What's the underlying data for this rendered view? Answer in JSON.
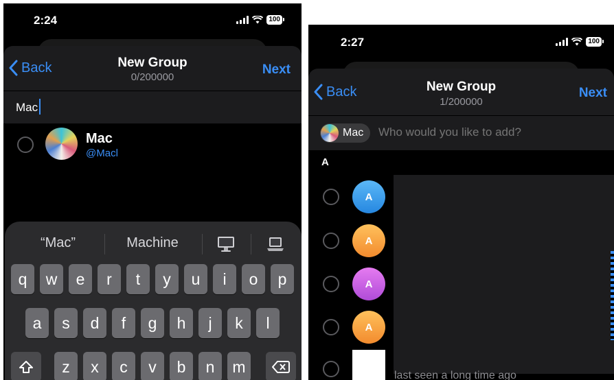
{
  "left": {
    "status": {
      "time": "2:24",
      "battery": "100"
    },
    "nav": {
      "back": "Back",
      "title": "New Group",
      "subtitle": "0/200000",
      "next": "Next"
    },
    "search": {
      "value": "Mac"
    },
    "result": {
      "name": "Mac",
      "username": "@Macl"
    },
    "keyboard": {
      "suggestions": [
        "“Mac”",
        "Machine"
      ],
      "row1": [
        "q",
        "w",
        "e",
        "r",
        "t",
        "y",
        "u",
        "i",
        "o",
        "p"
      ],
      "row2": [
        "a",
        "s",
        "d",
        "f",
        "g",
        "h",
        "j",
        "k",
        "l"
      ],
      "row3": [
        "z",
        "x",
        "c",
        "v",
        "b",
        "n",
        "m"
      ]
    }
  },
  "right": {
    "status": {
      "time": "2:27",
      "battery": "100"
    },
    "nav": {
      "back": "Back",
      "title": "New Group",
      "subtitle": "1/200000",
      "next": "Next"
    },
    "chip": {
      "label": "Mac"
    },
    "search": {
      "placeholder": "Who would you like to add?"
    },
    "section": {
      "header": "A"
    },
    "contacts": [
      {
        "initial": "A",
        "color": "#2f9be8"
      },
      {
        "initial": "A",
        "color": "#f5a13b"
      },
      {
        "initial": "A",
        "color": "#c15ee0"
      },
      {
        "initial": "A",
        "color": "#f5a13b"
      }
    ],
    "last_seen": "last seen a long time ago"
  }
}
